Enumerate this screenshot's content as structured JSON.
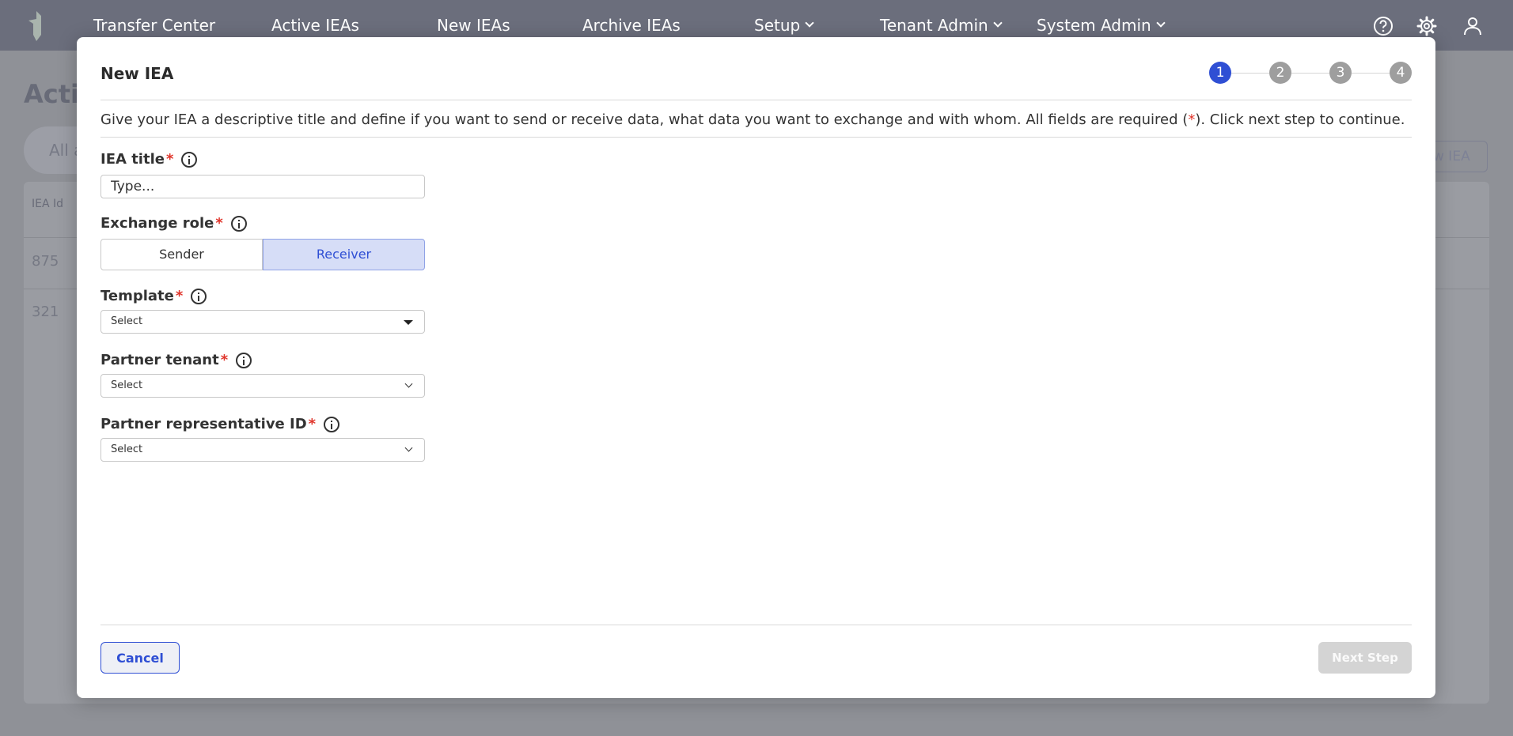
{
  "nav": {
    "items": [
      {
        "label": "Transfer Center"
      },
      {
        "label": "Active IEAs"
      },
      {
        "label": "New IEAs"
      },
      {
        "label": "Archive IEAs"
      },
      {
        "label": "Setup"
      },
      {
        "label": "Tenant Admin"
      },
      {
        "label": "System Admin"
      }
    ],
    "icons": [
      "help-icon",
      "gear-icon",
      "user-icon"
    ]
  },
  "background": {
    "title": "Acti",
    "search_text": "All a",
    "button_label": "w IEA",
    "column_header": "IEA Id",
    "rows": [
      "875",
      "321"
    ]
  },
  "modal": {
    "title": "New IEA",
    "steps": [
      "1",
      "2",
      "3",
      "4"
    ],
    "active_step": 1,
    "intro_before": "Give your IEA a descriptive title and define if you want to send or receive data, what data you want to exchange and with whom. All fields are required (",
    "intro_star": "*",
    "intro_after": "). Click next step to continue.",
    "required_mark": "*",
    "fields": {
      "title": {
        "label": "IEA title",
        "placeholder": "Type..."
      },
      "role": {
        "label": "Exchange role",
        "options": [
          "Sender",
          "Receiver"
        ],
        "selected": "Receiver"
      },
      "template": {
        "label": "Template",
        "value": "Select"
      },
      "partner_tenant": {
        "label": "Partner tenant",
        "value": "Select"
      },
      "partner_rep": {
        "label": "Partner representative ID",
        "value": "Select"
      }
    },
    "cancel_label": "Cancel",
    "next_label": "Next Step"
  },
  "colors": {
    "accent": "#2f4fd4",
    "required": "#e0352b",
    "nav_bg": "#6b6e7c",
    "segment_selected_bg": "#d6ddf7",
    "disabled_button": "#d4d4d4"
  }
}
